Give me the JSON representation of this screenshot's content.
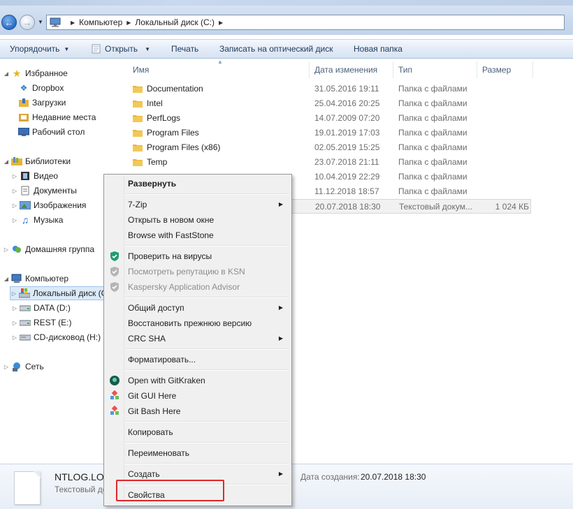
{
  "address": {
    "crumbs": [
      "Компьютер",
      "Локальный диск (C:)"
    ]
  },
  "toolbar": {
    "organize": "Упорядочить",
    "open": "Открыть",
    "print": "Печать",
    "burn": "Записать на оптический диск",
    "new_folder": "Новая папка"
  },
  "nav": {
    "favorites": "Избранное",
    "dropbox": "Dropbox",
    "downloads": "Загрузки",
    "recent": "Недавние места",
    "desktop": "Рабочий стол",
    "libraries": "Библиотеки",
    "video": "Видео",
    "documents": "Документы",
    "pictures": "Изображения",
    "music": "Музыка",
    "homegroup": "Домашняя группа",
    "computer": "Компьютер",
    "drive_c": "Локальный диск (C",
    "drive_d": "DATA (D:)",
    "drive_e": "REST (E:)",
    "drive_h": "CD-дисковод (H:)",
    "network": "Сеть"
  },
  "columns": {
    "name": "Имя",
    "date": "Дата изменения",
    "type": "Тип",
    "size": "Размер"
  },
  "rows": [
    {
      "name": "Documentation",
      "date": "31.05.2016 19:11",
      "type": "Папка с файлами",
      "size": ""
    },
    {
      "name": "Intel",
      "date": "25.04.2016 20:25",
      "type": "Папка с файлами",
      "size": ""
    },
    {
      "name": "PerfLogs",
      "date": "14.07.2009 07:20",
      "type": "Папка с файлами",
      "size": ""
    },
    {
      "name": "Program Files",
      "date": "19.01.2019 17:03",
      "type": "Папка с файлами",
      "size": ""
    },
    {
      "name": "Program Files (x86)",
      "date": "02.05.2019 15:25",
      "type": "Папка с файлами",
      "size": ""
    },
    {
      "name": "Temp",
      "date": "23.07.2018 21:11",
      "type": "Папка с файлами",
      "size": ""
    },
    {
      "name": "",
      "date": "10.04.2019 22:29",
      "type": "Папка с файлами",
      "size": ""
    },
    {
      "name": "",
      "date": "11.12.2018 18:57",
      "type": "Папка с файлами",
      "size": ""
    },
    {
      "name": "",
      "date": "20.07.2018 18:30",
      "type": "Текстовый докум...",
      "size": "1 024 КБ"
    }
  ],
  "details": {
    "file_name": "NTLOG.LOG",
    "file_type": "Текстовый до",
    "created_label": "Дата создания:",
    "created_value": "20.07.2018 18:30"
  },
  "context_menu": {
    "expand": "Развернуть",
    "zip": "7-Zip",
    "open_new_window": "Открыть в новом окне",
    "faststone": "Browse with FastStone",
    "scan": "Проверить на вирусы",
    "ksn": "Посмотреть репутацию в KSN",
    "kaspersky_advisor": "Kaspersky Application Advisor",
    "share": "Общий доступ",
    "restore": "Восстановить прежнюю версию",
    "crc": "CRC SHA",
    "format": "Форматировать...",
    "gitkraken": "Open with GitKraken",
    "git_gui": "Git GUI Here",
    "git_bash": "Git Bash Here",
    "copy": "Копировать",
    "rename": "Переименовать",
    "create": "Создать",
    "properties": "Свойства"
  },
  "colors": {
    "highlight_box": "#e0282b",
    "folder": "#e8b43a",
    "selection": "#dbeaf9"
  }
}
